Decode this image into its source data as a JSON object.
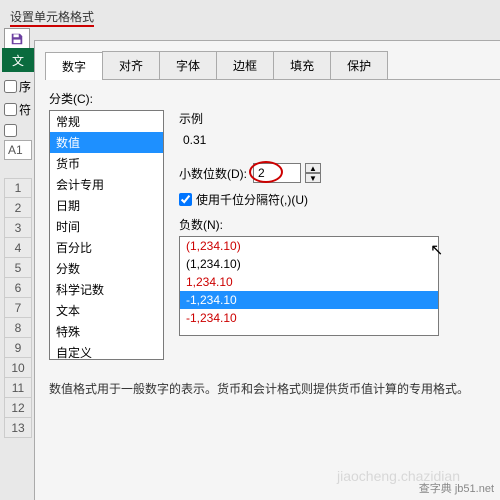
{
  "titlebar": {
    "title": "设置单元格格式"
  },
  "ribbon": {
    "file_tab": "文"
  },
  "left": {
    "cb1": "序",
    "cb2": "符",
    "cb3": "",
    "namebox": "A1"
  },
  "rows": [
    "1",
    "2",
    "3",
    "4",
    "5",
    "6",
    "7",
    "8",
    "9",
    "10",
    "11",
    "12",
    "13"
  ],
  "tabs": {
    "t0": "数字",
    "t1": "对齐",
    "t2": "字体",
    "t3": "边框",
    "t4": "填充",
    "t5": "保护"
  },
  "category": {
    "label": "分类(C):",
    "items": {
      "i0": "常规",
      "i1": "数值",
      "i2": "货币",
      "i3": "会计专用",
      "i4": "日期",
      "i5": "时间",
      "i6": "百分比",
      "i7": "分数",
      "i8": "科学记数",
      "i9": "文本",
      "i10": "特殊",
      "i11": "自定义"
    }
  },
  "sample": {
    "label": "示例",
    "value": "0.31"
  },
  "decimal": {
    "label": "小数位数(D):",
    "value": "2"
  },
  "thousands": {
    "label": "使用千位分隔符(,)(U)"
  },
  "negative": {
    "label": "负数(N):",
    "items": {
      "n0": "(1,234.10)",
      "n1": "(1,234.10)",
      "n2": "1,234.10",
      "n3": "-1,234.10",
      "n4": "-1,234.10"
    }
  },
  "description": "数值格式用于一般数字的表示。货币和会计格式则提供货币值计算的专用格式。",
  "watermark": {
    "site": "查字典 jb51.net",
    "sub": "jiaocheng.chazidian"
  },
  "chart_data": {
    "type": "table",
    "title": "设置单元格格式 – 数字 – 数值",
    "sample_value": 0.31,
    "decimal_places": 2,
    "use_thousands_separator": true,
    "negative_formats": [
      {
        "display": "(1,234.10)",
        "color": "red"
      },
      {
        "display": "(1,234.10)",
        "color": "black"
      },
      {
        "display": "1,234.10",
        "color": "red"
      },
      {
        "display": "-1,234.10",
        "color": "black",
        "selected": true
      },
      {
        "display": "-1,234.10",
        "color": "red"
      }
    ],
    "categories": [
      "常规",
      "数值",
      "货币",
      "会计专用",
      "日期",
      "时间",
      "百分比",
      "分数",
      "科学记数",
      "文本",
      "特殊",
      "自定义"
    ],
    "selected_category": "数值"
  }
}
